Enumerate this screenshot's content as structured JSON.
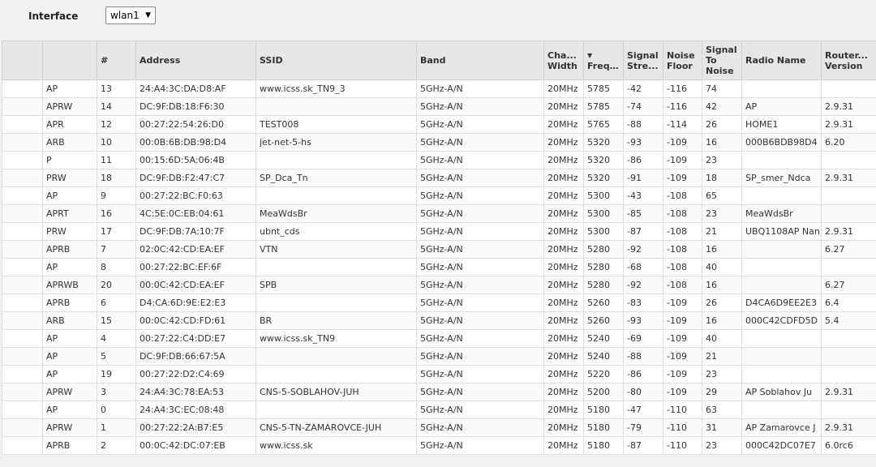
{
  "interface": {
    "label": "Interface",
    "value": "wlan1"
  },
  "columns": {
    "num": "#",
    "address": "Address",
    "ssid": "SSID",
    "band": "Band",
    "channel_width": [
      "Cha...",
      "Width"
    ],
    "frequency_sort": "▼",
    "frequency": "Freq...",
    "signal_strength": [
      "Signal",
      "Stre..."
    ],
    "noise_floor": [
      "Noise",
      "Floor"
    ],
    "signal_to_noise": [
      "Signal",
      "To",
      "Noise"
    ],
    "radio_name": "Radio Name",
    "router_version": [
      "Router...",
      "Version"
    ]
  },
  "rows": [
    {
      "flags": "AP",
      "num": "13",
      "address": "24:A4:3C:DA:D8:AF",
      "ssid": "www.icss.sk_TN9_3",
      "band": "5GHz-A/N",
      "width": "20MHz",
      "freq": "5785",
      "signal": "-42",
      "noise": "-116",
      "snr": "74",
      "radio": "",
      "version": ""
    },
    {
      "flags": "APRW",
      "num": "14",
      "address": "DC:9F:DB:18:F6:30",
      "ssid": "",
      "band": "5GHz-A/N",
      "width": "20MHz",
      "freq": "5785",
      "signal": "-74",
      "noise": "-116",
      "snr": "42",
      "radio": "AP",
      "version": "2.9.31"
    },
    {
      "flags": "APR",
      "num": "12",
      "address": "00:27:22:54:26:D0",
      "ssid": "TEST008",
      "band": "5GHz-A/N",
      "width": "20MHz",
      "freq": "5765",
      "signal": "-88",
      "noise": "-114",
      "snr": "26",
      "radio": "HOME1",
      "version": "2.9.31"
    },
    {
      "flags": "ARB",
      "num": "10",
      "address": "00:0B:6B:DB:98:D4",
      "ssid": "jet-net-5-hs",
      "band": "5GHz-A/N",
      "width": "20MHz",
      "freq": "5320",
      "signal": "-93",
      "noise": "-109",
      "snr": "16",
      "radio": "000B6BDB98D4",
      "version": "6.20"
    },
    {
      "flags": "P",
      "num": "11",
      "address": "00:15:6D:5A:06:4B",
      "ssid": "",
      "band": "5GHz-A/N",
      "width": "20MHz",
      "freq": "5320",
      "signal": "-86",
      "noise": "-109",
      "snr": "23",
      "radio": "",
      "version": ""
    },
    {
      "flags": "PRW",
      "num": "18",
      "address": "DC:9F:DB:F2:47:C7",
      "ssid": "SP_Dca_Tn",
      "band": "5GHz-A/N",
      "width": "20MHz",
      "freq": "5320",
      "signal": "-91",
      "noise": "-109",
      "snr": "18",
      "radio": "SP_smer_Ndca",
      "version": "2.9.31"
    },
    {
      "flags": "AP",
      "num": "9",
      "address": "00:27:22:BC:F0:63",
      "ssid": "",
      "band": "5GHz-A/N",
      "width": "20MHz",
      "freq": "5300",
      "signal": "-43",
      "noise": "-108",
      "snr": "65",
      "radio": "",
      "version": ""
    },
    {
      "flags": "APRT",
      "num": "16",
      "address": "4C:5E:0C:EB:04:61",
      "ssid": "MeaWdsBr",
      "band": "5GHz-A/N",
      "width": "20MHz",
      "freq": "5300",
      "signal": "-85",
      "noise": "-108",
      "snr": "23",
      "radio": "MeaWdsBr",
      "version": ""
    },
    {
      "flags": "PRW",
      "num": "17",
      "address": "DC:9F:DB:7A:10:7F",
      "ssid": "ubnt_cds",
      "band": "5GHz-A/N",
      "width": "20MHz",
      "freq": "5300",
      "signal": "-87",
      "noise": "-108",
      "snr": "21",
      "radio": "UBQ1108AP Nan",
      "version": "2.9.31"
    },
    {
      "flags": "APRB",
      "num": "7",
      "address": "02:0C:42:CD:EA:EF",
      "ssid": "VTN",
      "band": "5GHz-A/N",
      "width": "20MHz",
      "freq": "5280",
      "signal": "-92",
      "noise": "-108",
      "snr": "16",
      "radio": "",
      "version": "6.27"
    },
    {
      "flags": "AP",
      "num": "8",
      "address": "00:27:22:BC:EF:6F",
      "ssid": "",
      "band": "5GHz-A/N",
      "width": "20MHz",
      "freq": "5280",
      "signal": "-68",
      "noise": "-108",
      "snr": "40",
      "radio": "",
      "version": ""
    },
    {
      "flags": "APRWB",
      "num": "20",
      "address": "00:0C:42:CD:EA:EF",
      "ssid": "SPB",
      "band": "5GHz-A/N",
      "width": "20MHz",
      "freq": "5280",
      "signal": "-92",
      "noise": "-108",
      "snr": "16",
      "radio": "",
      "version": "6.27"
    },
    {
      "flags": "APRB",
      "num": "6",
      "address": "D4:CA:6D:9E:E2:E3",
      "ssid": "",
      "band": "5GHz-A/N",
      "width": "20MHz",
      "freq": "5260",
      "signal": "-83",
      "noise": "-109",
      "snr": "26",
      "radio": "D4CA6D9EE2E3",
      "version": "6.4"
    },
    {
      "flags": "ARB",
      "num": "15",
      "address": "00:0C:42:CD:FD:61",
      "ssid": "BR",
      "band": "5GHz-A/N",
      "width": "20MHz",
      "freq": "5260",
      "signal": "-93",
      "noise": "-109",
      "snr": "16",
      "radio": "000C42CDFD5D",
      "version": "5.4"
    },
    {
      "flags": "AP",
      "num": "4",
      "address": "00:27:22:C4:DD:E7",
      "ssid": "www.icss.sk_TN9",
      "band": "5GHz-A/N",
      "width": "20MHz",
      "freq": "5240",
      "signal": "-69",
      "noise": "-109",
      "snr": "40",
      "radio": "",
      "version": ""
    },
    {
      "flags": "AP",
      "num": "5",
      "address": "DC:9F:DB:66:67:5A",
      "ssid": "",
      "band": "5GHz-A/N",
      "width": "20MHz",
      "freq": "5240",
      "signal": "-88",
      "noise": "-109",
      "snr": "21",
      "radio": "",
      "version": ""
    },
    {
      "flags": "AP",
      "num": "19",
      "address": "00:27:22:D2:C4:69",
      "ssid": "",
      "band": "5GHz-A/N",
      "width": "20MHz",
      "freq": "5220",
      "signal": "-86",
      "noise": "-109",
      "snr": "23",
      "radio": "",
      "version": ""
    },
    {
      "flags": "APRW",
      "num": "3",
      "address": "24:A4:3C:78:EA:53",
      "ssid": "CNS-5-SOBLAHOV-JUH",
      "band": "5GHz-A/N",
      "width": "20MHz",
      "freq": "5200",
      "signal": "-80",
      "noise": "-109",
      "snr": "29",
      "radio": "AP Soblahov Ju",
      "version": "2.9.31"
    },
    {
      "flags": "AP",
      "num": "0",
      "address": "24:A4:3C:EC:08:48",
      "ssid": "",
      "band": "5GHz-A/N",
      "width": "20MHz",
      "freq": "5180",
      "signal": "-47",
      "noise": "-110",
      "snr": "63",
      "radio": "",
      "version": ""
    },
    {
      "flags": "APRW",
      "num": "1",
      "address": "00:27:22:2A:B7:E5",
      "ssid": "CNS-5-TN-ZAMAROVCE-JUH",
      "band": "5GHz-A/N",
      "width": "20MHz",
      "freq": "5180",
      "signal": "-79",
      "noise": "-110",
      "snr": "31",
      "radio": "AP Zamarovce J",
      "version": "2.9.31"
    },
    {
      "flags": "APRB",
      "num": "2",
      "address": "00:0C:42:DC:07:EB",
      "ssid": "www.icss.sk",
      "band": "5GHz-A/N",
      "width": "20MHz",
      "freq": "5180",
      "signal": "-87",
      "noise": "-110",
      "snr": "23",
      "radio": "000C42DC07E7",
      "version": "6.0rc6"
    }
  ]
}
